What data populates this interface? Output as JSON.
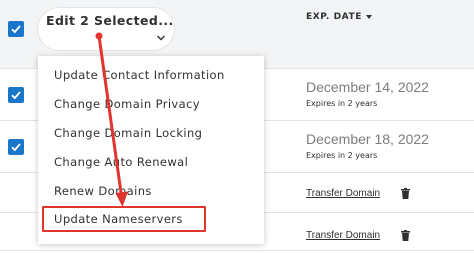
{
  "bulk_action": {
    "edit_label": "Edit 2 Selected...",
    "chevron_icon": "chevron-down-icon"
  },
  "table": {
    "column_header": "EXP. DATE",
    "sort_icon": "caret-down-icon",
    "rows": [
      {
        "checked": true,
        "date": "December 14, 2022",
        "expires": "Expires in 2 years"
      },
      {
        "checked": true,
        "date": "December 18, 2022",
        "expires": "Expires in 2 years"
      },
      {
        "checked": false,
        "link": "Transfer Domain",
        "icon": "trash-icon"
      },
      {
        "checked": false,
        "link": "Transfer Domain",
        "icon": "trash-icon"
      }
    ]
  },
  "dropdown": {
    "items": [
      {
        "label": "Update Contact Information"
      },
      {
        "label": "Change Domain Privacy"
      },
      {
        "label": "Change Domain Locking"
      },
      {
        "label": "Change Auto Renewal"
      },
      {
        "label": "Renew Domains"
      },
      {
        "label": "Update Nameservers",
        "highlighted": true
      }
    ]
  },
  "colors": {
    "checkbox": "#1976c8",
    "annotation_red": "#e0342f",
    "header_band": "#f3f4f5"
  }
}
